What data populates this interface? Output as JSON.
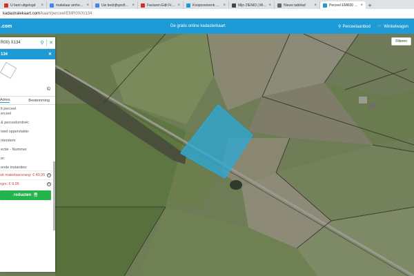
{
  "browser": {
    "tabs": [
      {
        "label": "U bent uitgelogd",
        "color": "#d93025"
      },
      {
        "label": "makelaar arnhem - G",
        "color": "#4285f4"
      },
      {
        "label": "Uw bedrijfsprofiel op",
        "color": "#4285f4"
      },
      {
        "label": "Facturen Edit Fresen",
        "color": "#d93025"
      },
      {
        "label": "Koopovereenk Schoo",
        "color": "#1e9ad6"
      },
      {
        "label": "Mijn ZIENID | Mijn ov",
        "color": "#444444"
      },
      {
        "label": "Nieuw tabblad",
        "color": "#666666"
      },
      {
        "label": "Perceel EMR00 X134",
        "color": "#1e9ad6"
      }
    ],
    "url_host": "kadastralekaart.com",
    "url_path": "/kaart/perceel/EMR00/X/134"
  },
  "header": {
    "brand": ".com",
    "tagline": "De gratis online kadasterkaart",
    "link_offer": "Perceelaanbod",
    "link_cart": "Winkelwagen"
  },
  "map": {
    "filter_label": "Filteren",
    "parcel_color": "#29a9d9"
  },
  "panel": {
    "search_value": "R00) X134",
    "title": "134",
    "tab_address": "Adres",
    "tab_destination": "Bestemming",
    "rows": [
      "lt perceel",
      "erceel",
      "",
      "& perceelomtrek:",
      "",
      "owd oppervlakte:",
      "",
      "nterstem",
      "",
      "ectie - Nummer",
      "",
      "er:",
      "",
      "ende instanties:"
    ],
    "price1": "uit-makelaarsrang: € 49,95",
    "price2": "rgrs: € 9,95",
    "cta": "roducten"
  }
}
